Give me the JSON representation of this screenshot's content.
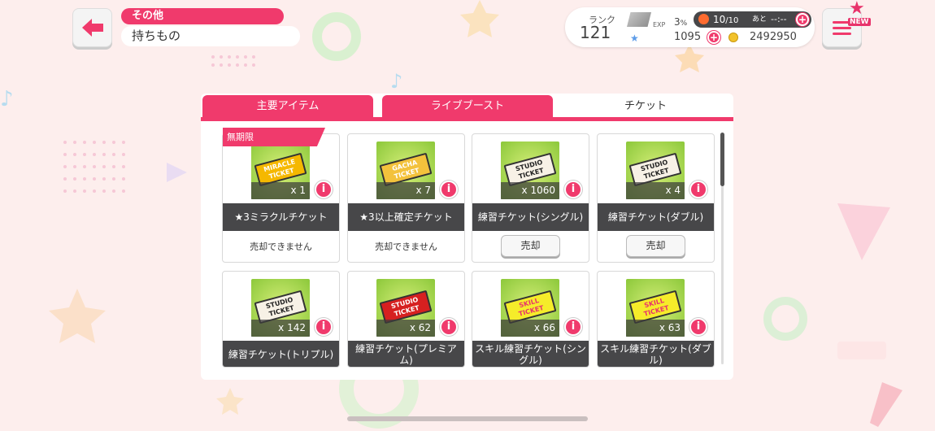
{
  "header": {
    "breadcrumb": "その他",
    "title": "持ちもの"
  },
  "status": {
    "rank_label": "ランク",
    "rank_value": "121",
    "exp_label": "EXP",
    "exp_percent": "3",
    "exp_unit": "%",
    "stamina_value": "10",
    "stamina_max": "/10",
    "stamina_after": "あと",
    "stamina_timer": "--:--",
    "stars": "1095",
    "coins": "2492950"
  },
  "menu": {
    "badge": "NEW"
  },
  "tabs": [
    {
      "label": "主要アイテム"
    },
    {
      "label": "ライブブースト"
    },
    {
      "label": "チケット"
    }
  ],
  "ribbon_label": "無期限",
  "info_symbol": "i",
  "items": [
    {
      "ticket_text": "MIRACLE TICKET",
      "count": "x 1",
      "name": "★3ミラクルチケット",
      "note": "売却できません"
    },
    {
      "ticket_text": "GACHA TICKET",
      "count": "x 7",
      "name": "★3以上確定チケット",
      "note": "売却できません"
    },
    {
      "ticket_text": "STUDIO TICKET",
      "count": "x 1060",
      "name": "練習チケット(シングル)",
      "sell": "売却"
    },
    {
      "ticket_text": "STUDIO TICKET",
      "count": "x 4",
      "name": "練習チケット(ダブル)",
      "sell": "売却"
    },
    {
      "ticket_text": "STUDIO TICKET",
      "count": "x 142",
      "name": "練習チケット(トリプル)"
    },
    {
      "ticket_text": "STUDIO TICKET",
      "count": "x 62",
      "name": "練習チケット(プレミアム)"
    },
    {
      "ticket_text": "SKILL TICKET",
      "count": "x 66",
      "name": "スキル練習チケット(シングル)"
    },
    {
      "ticket_text": "SKILL TICKET",
      "count": "x 63",
      "name": "スキル練習チケット(ダブル)"
    }
  ],
  "colors": {
    "accent": "#f03a6c",
    "dark_bar": "#474749",
    "background": "#fdeeed",
    "miracle_ticket": "#f5b800",
    "gacha_ticket": "#f3c23c",
    "studio_ticket": "#f7f1e6",
    "studio_premium": "#d62020",
    "skill_ticket": "#f5ec2a"
  }
}
